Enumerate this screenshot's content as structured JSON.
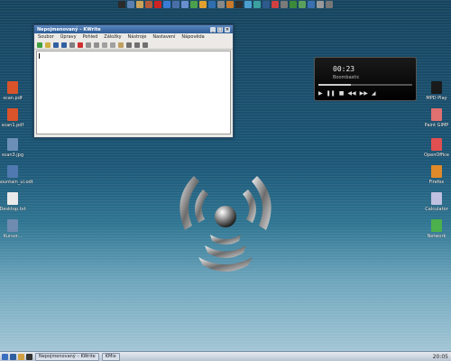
{
  "top_launcher": {
    "icons": [
      {
        "name": "terminal-icon",
        "color": "#2b2b2b"
      },
      {
        "name": "display-icon",
        "color": "#5a7fb0"
      },
      {
        "name": "home-icon",
        "color": "#c9a35a"
      },
      {
        "name": "settings-icon",
        "color": "#b35a3a"
      },
      {
        "name": "opera-icon",
        "color": "#cc2222"
      },
      {
        "name": "globe-icon",
        "color": "#3a7bd5"
      },
      {
        "name": "box-icon",
        "color": "#4a6fa8"
      },
      {
        "name": "document-icon",
        "color": "#6a8fcf"
      },
      {
        "name": "spreadsheet-icon",
        "color": "#4ca04c"
      },
      {
        "name": "chart-icon",
        "color": "#e0a030"
      },
      {
        "name": "tools-icon",
        "color": "#2f6fb0"
      },
      {
        "name": "gear-icon",
        "color": "#888888"
      },
      {
        "name": "image-icon",
        "color": "#ca7a2a"
      },
      {
        "name": "music-icon",
        "color": "#303030"
      },
      {
        "name": "network-icon",
        "color": "#4ca0d0"
      },
      {
        "name": "paint-icon",
        "color": "#3aa0a0"
      },
      {
        "name": "calculator-icon",
        "color": "#2e5a8e"
      },
      {
        "name": "calendar-icon",
        "color": "#d04040"
      },
      {
        "name": "printer-icon",
        "color": "#7a7a7a"
      },
      {
        "name": "mail-icon",
        "color": "#3a8a3a"
      },
      {
        "name": "refresh-icon",
        "color": "#5aa05a"
      },
      {
        "name": "flag-icon",
        "color": "#3a70b0"
      },
      {
        "name": "lock-icon",
        "color": "#999999"
      },
      {
        "name": "trash-icon",
        "color": "#777777"
      }
    ]
  },
  "desktop_left": [
    {
      "label": "scan.pdf",
      "icon": "pdf-file-icon",
      "color": "#d9532b"
    },
    {
      "label": "scan1.pdf",
      "icon": "pdf-file-icon",
      "color": "#d9532b"
    },
    {
      "label": "scan3.jpg",
      "icon": "image-file-icon",
      "color": "#6c8fb8"
    },
    {
      "label": "mountain_ui.odt",
      "icon": "document-file-icon",
      "color": "#4f79b0"
    },
    {
      "label": "Desktop.txt",
      "icon": "text-file-icon",
      "color": "#eaeaea"
    },
    {
      "label": "Kursor...",
      "icon": "file-icon",
      "color": "#6f8bb0"
    }
  ],
  "desktop_right": [
    {
      "label": "MPD Play",
      "icon": "terminal-app-icon",
      "color": "#1a1a1a"
    },
    {
      "label": "Paint GIMP",
      "icon": "gimp-icon",
      "color": "#e07070"
    },
    {
      "label": "OpenOffice",
      "icon": "office-icon",
      "color": "#e05050"
    },
    {
      "label": "Firefox",
      "icon": "firefox-icon",
      "color": "#e08a2a"
    },
    {
      "label": "Calculator",
      "icon": "calculator-icon",
      "color": "#c0c0e0"
    },
    {
      "label": "Network",
      "icon": "network-icon",
      "color": "#4cb04c"
    }
  ],
  "kwrite_window": {
    "title": "Nepojmenovaný – KWrite",
    "menu": [
      "Soubor",
      "Úpravy",
      "Pohled",
      "Záložky",
      "Nástroje",
      "Nastavení",
      "Nápověda"
    ],
    "toolbar": [
      {
        "name": "new-document-icon",
        "color": "#40a040"
      },
      {
        "name": "open-folder-icon",
        "color": "#d0b040"
      },
      {
        "name": "save-icon",
        "color": "#3060a0"
      },
      {
        "name": "save-as-icon",
        "color": "#3060a0"
      },
      {
        "name": "print-icon",
        "color": "#808080"
      },
      {
        "name": "close-document-icon",
        "color": "#d03030"
      },
      {
        "name": "undo-icon",
        "color": "#909090"
      },
      {
        "name": "redo-icon",
        "color": "#909090"
      },
      {
        "name": "cut-icon",
        "color": "#a0a0a0"
      },
      {
        "name": "copy-icon",
        "color": "#a0a0a0"
      },
      {
        "name": "paste-icon",
        "color": "#c0a060"
      },
      {
        "name": "find-icon",
        "color": "#707070"
      },
      {
        "name": "replace-icon",
        "color": "#707070"
      },
      {
        "name": "spellcheck-icon",
        "color": "#707070"
      }
    ]
  },
  "media_player": {
    "time": "00:23",
    "song": "Boombastic"
  },
  "taskbar": {
    "launcher_icons": [
      {
        "name": "kde-menu-icon",
        "color": "#3a6fc0"
      },
      {
        "name": "konqueror-icon",
        "color": "#2f5fa0"
      },
      {
        "name": "home-folder-icon",
        "color": "#d0a040"
      },
      {
        "name": "terminal-icon",
        "color": "#333333"
      }
    ],
    "tasks": [
      {
        "label": "Nepojmenovaný – KWrite"
      },
      {
        "label": "KMix"
      }
    ],
    "clock": "20:05"
  }
}
